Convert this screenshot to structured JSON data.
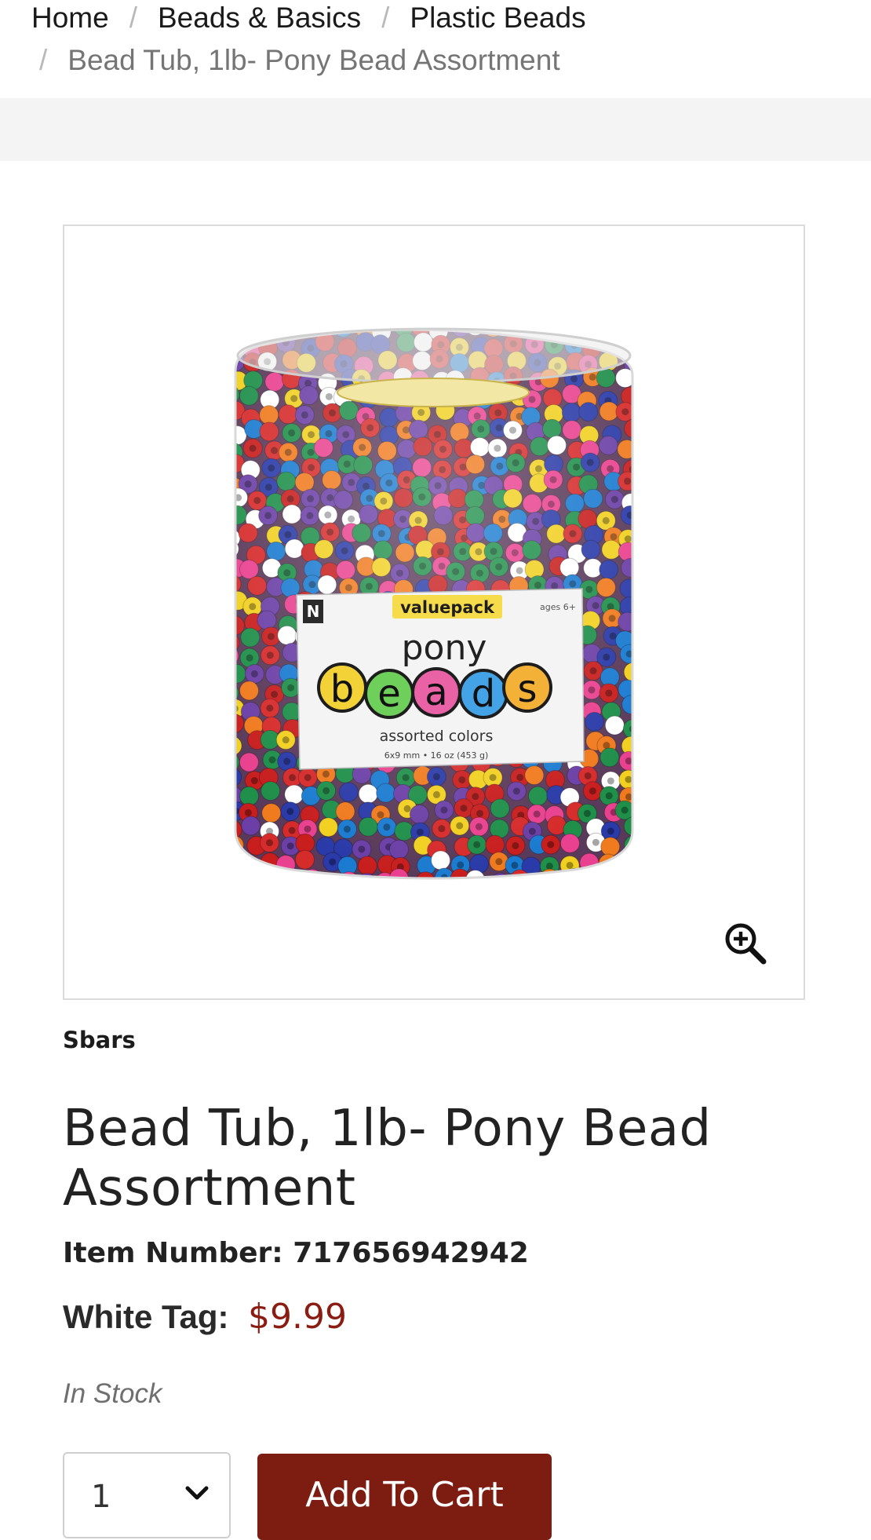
{
  "breadcrumb": {
    "items": [
      {
        "label": "Home"
      },
      {
        "label": "Beads & Basics"
      },
      {
        "label": "Plastic Beads"
      }
    ],
    "separator": "/",
    "current": "Bead Tub, 1lb- Pony Bead Assortment"
  },
  "product": {
    "image": {
      "label_top": "valuepack",
      "label_age": "ages 6+",
      "label_line1": "pony",
      "label_line2": [
        "b",
        "e",
        "a",
        "d",
        "s"
      ],
      "label_sub": "assorted colors",
      "label_size": "6x9 mm • 16 oz (453 g)",
      "brand_mark": "N"
    },
    "zoom_icon": "zoom-in-icon",
    "brand": "Sbars",
    "title": "Bead Tub, 1lb- Pony Bead Assortment",
    "item_number_text": "Item Number: 717656942942",
    "price_label": "White Tag:",
    "price": "$9.99",
    "stock_status": "In Stock",
    "quantity": "1",
    "add_to_cart_label": "Add To Cart"
  },
  "colors": {
    "price": "#8a1c12",
    "button": "#7d1c11",
    "band": "#f4f4f4"
  }
}
